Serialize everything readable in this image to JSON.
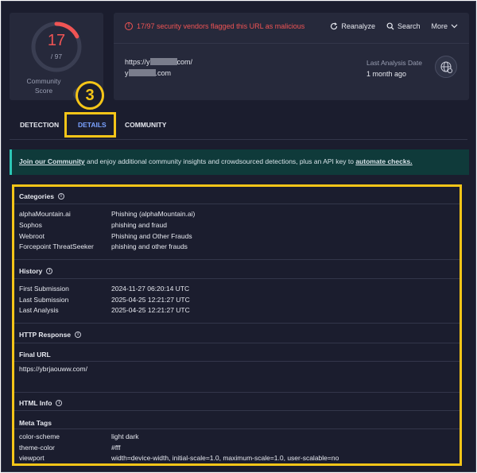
{
  "score": {
    "value": "17",
    "total": "/ 97",
    "label": "Community Score",
    "ring_fraction": 0.175
  },
  "callout_number": "3",
  "header": {
    "alert": "17/97 security vendors flagged this URL as malicious",
    "actions": [
      "Reanalyze",
      "Search",
      "More"
    ],
    "url_prefix": "https://y",
    "url_suffix": "com/",
    "host_prefix": "y",
    "host_suffix": ".com",
    "last_analysis_label": "Last Analysis Date",
    "last_analysis_value": "1 month ago"
  },
  "tabs": {
    "detection": "DETECTION",
    "details": "DETAILS",
    "community": "COMMUNITY"
  },
  "banner": {
    "link1": "Join our Community",
    "text": " and enjoy additional community insights and crowdsourced detections, plus an API key to ",
    "link2": "automate checks."
  },
  "details": {
    "categories": {
      "title": "Categories",
      "rows": [
        {
          "k": "alphaMountain.ai",
          "v": "Phishing (alphaMountain.ai)"
        },
        {
          "k": "Sophos",
          "v": "phishing and fraud"
        },
        {
          "k": "Webroot",
          "v": "Phishing and Other Frauds"
        },
        {
          "k": "Forcepoint ThreatSeeker",
          "v": "phishing and other frauds"
        }
      ]
    },
    "history": {
      "title": "History",
      "rows": [
        {
          "k": "First Submission",
          "v": "2024-11-27 06:20:14 UTC"
        },
        {
          "k": "Last Submission",
          "v": "2025-04-25 12:21:27 UTC"
        },
        {
          "k": "Last Analysis",
          "v": "2025-04-25 12:21:27 UTC"
        }
      ]
    },
    "http": {
      "title": "HTTP Response",
      "final_url_label": "Final URL",
      "final_url": "https://ybrjaouww.com/"
    },
    "html": {
      "title": "HTML Info",
      "meta_label": "Meta Tags",
      "rows": [
        {
          "k": "color-scheme",
          "v": "light dark"
        },
        {
          "k": "theme-color",
          "v": "#fff"
        },
        {
          "k": "viewport",
          "v": "width=device-width, initial-scale=1.0, maximum-scale=1.0, user-scalable=no"
        }
      ]
    }
  },
  "colors": {
    "accent_red": "#f05454",
    "accent_blue": "#7aa2ff",
    "highlight": "#f5c518",
    "banner_bg": "#0f3a3a"
  }
}
